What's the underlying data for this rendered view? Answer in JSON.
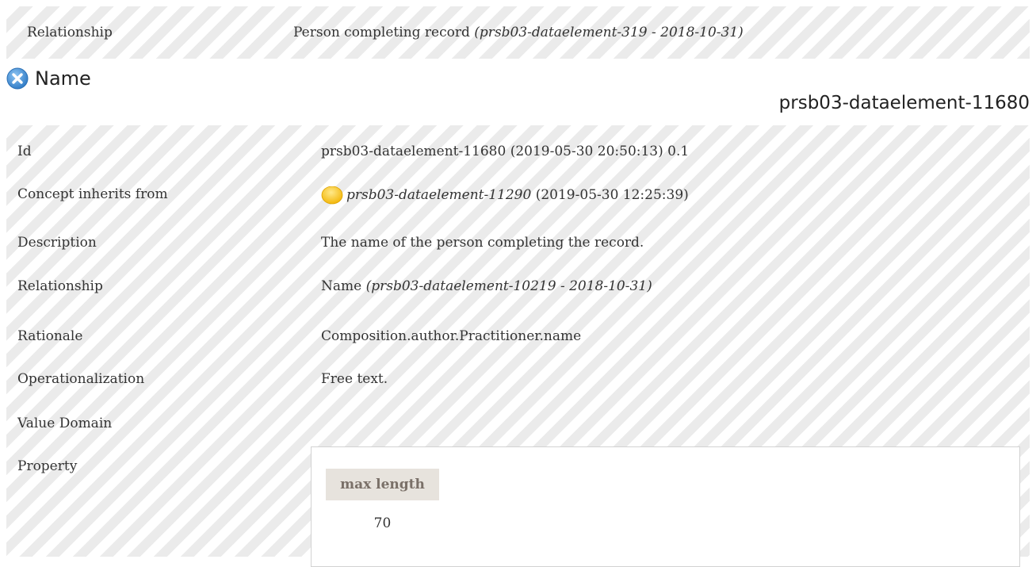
{
  "top_row": {
    "label": "Relationship",
    "value_text": "Person completing record ",
    "value_ref": "(prsb03-dataelement-319 - 2018-10-31)"
  },
  "section": {
    "title": "Name",
    "identifier": "prsb03-dataelement-11680",
    "icon": "close-circle-icon"
  },
  "rows": {
    "id": {
      "label": "Id",
      "value": "prsb03-dataelement-11680 (2019-05-30 20:50:13) 0.1"
    },
    "inherits": {
      "label": "Concept inherits from",
      "icon": "status-yellow-dot-icon",
      "link": "prsb03-dataelement-11290",
      "value": " (2019-05-30 12:25:39)"
    },
    "description": {
      "label": "Description",
      "value": "The name of the person completing the record."
    },
    "relationship": {
      "label": "Relationship",
      "value_text": "Name ",
      "value_ref": "(prsb03-dataelement-10219 - 2018-10-31)"
    },
    "rationale": {
      "label": "Rationale",
      "value": "Composition.author.Practitioner.name"
    },
    "operationalization": {
      "label": "Operationalization",
      "value": "Free text."
    },
    "value_domain": {
      "label": "Value Domain"
    },
    "property": {
      "label": "Property",
      "table": {
        "header": "max length",
        "value": "70"
      }
    }
  },
  "colors": {
    "stripe_light": "#ffffff",
    "stripe_dark": "#ebebeb",
    "icon_blue": "#3e8fd8",
    "dot_yellow": "#f6c215",
    "table_header_bg": "#e7e3dd"
  }
}
